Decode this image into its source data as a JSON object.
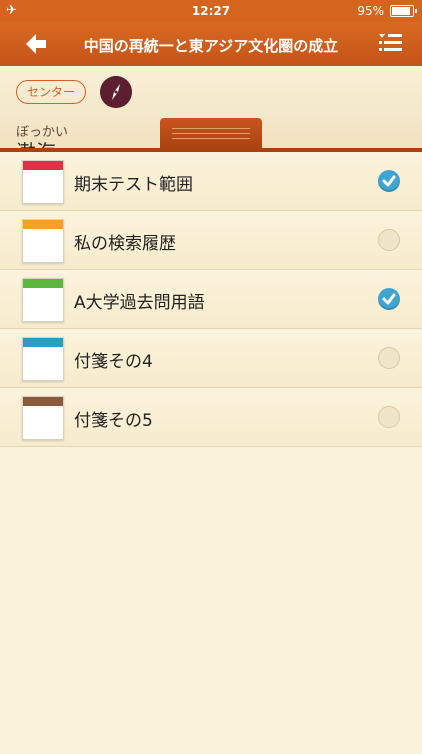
{
  "status_bar": {
    "time": "12:27",
    "battery": "95%",
    "airplane_icon": "airplane-icon"
  },
  "navbar": {
    "title": "中国の再統一と東アジア文化圏の成立",
    "back_icon": "back-arrow-icon",
    "menu_icon": "list-menu-icon"
  },
  "header": {
    "tag": "センター",
    "compass_icon": "compass-icon",
    "ruby": "ぼっかい",
    "word": "渤海"
  },
  "notes": [
    {
      "label": "期末テスト範囲",
      "color": "#e0304a",
      "checked": true
    },
    {
      "label": "私の検索履歴",
      "color": "#f0a22a",
      "checked": false
    },
    {
      "label": "A大学過去問用語",
      "color": "#5cb83c",
      "checked": true
    },
    {
      "label": "付箋その4",
      "color": "#2e9ac8",
      "checked": false
    },
    {
      "label": "付箋その5",
      "color": "#8a5a3a",
      "checked": false
    }
  ]
}
